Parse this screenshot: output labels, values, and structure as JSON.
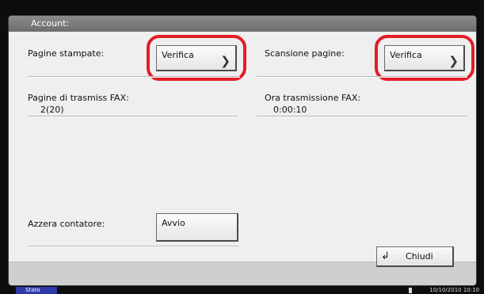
{
  "window": {
    "title": "Account:"
  },
  "fields": {
    "printed_pages_label": "Pagine stampate:",
    "scanned_pages_label": "Scansione pagine:",
    "fax_pages_label": "Pagine di trasmiss FAX:",
    "fax_pages_value": "2(20)",
    "fax_time_label": "Ora trasmissione FAX:",
    "fax_time_value": "0:00:10",
    "reset_counter_label": "Azzera contatore:"
  },
  "buttons": {
    "check_printed": "Verifica",
    "check_scanned": "Verifica",
    "start_reset": "Avvio",
    "close": "Chiudi"
  },
  "status_bar": {
    "status_label": "Stato",
    "datetime": "10/10/2010 10:10"
  },
  "colors": {
    "highlight": "#e31d27",
    "status_tab": "#2e3aa8"
  },
  "icons": {
    "button_arrow": "chevron-right-icon",
    "close": "return-arrow-icon"
  }
}
